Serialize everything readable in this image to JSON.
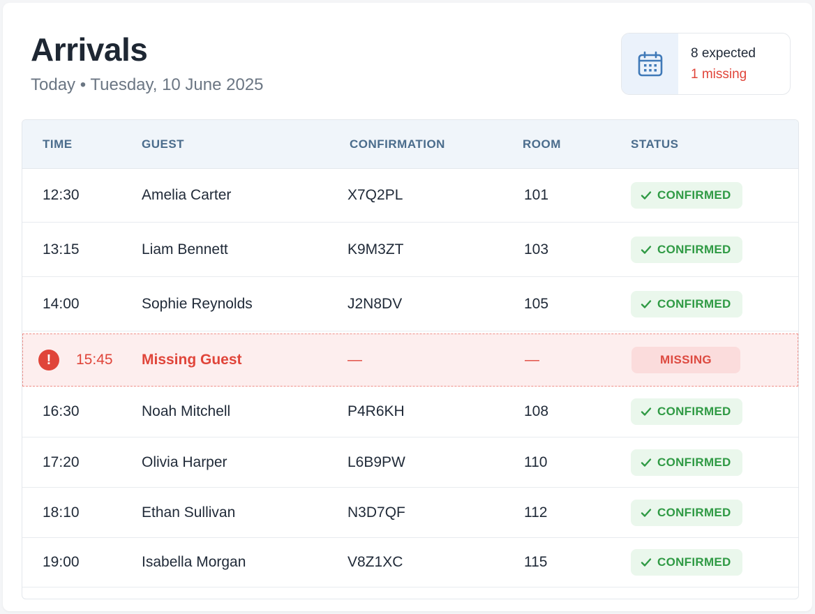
{
  "header": {
    "title": "Arrivals",
    "subtitle": "Today • Tuesday, 10 June 2025"
  },
  "summary": {
    "icon": "calendar-icon",
    "expected": "8 expected",
    "missing": "1 missing"
  },
  "table": {
    "columns": [
      "TIME",
      "GUEST",
      "CONFIRMATION",
      "ROOM",
      "STATUS"
    ],
    "rows": [
      {
        "time": "12:30",
        "guest": "Amelia Carter",
        "confirmation": "X7Q2PL",
        "room": "101",
        "status": "CONFIRMED"
      },
      {
        "time": "13:15",
        "guest": "Liam Bennett",
        "confirmation": "K9M3ZT",
        "room": "103",
        "status": "CONFIRMED"
      },
      {
        "time": "14:00",
        "guest": "Sophie Reynolds",
        "confirmation": "J2N8DV",
        "room": "105",
        "status": "CONFIRMED"
      },
      {
        "time": "15:45",
        "guest": "Missing Guest",
        "confirmation": "—",
        "room": "—",
        "status": "MISSING"
      },
      {
        "time": "16:30",
        "guest": "Noah Mitchell",
        "confirmation": "P4R6KH",
        "room": "108",
        "status": "CONFIRMED"
      },
      {
        "time": "17:20",
        "guest": "Olivia Harper",
        "confirmation": "L6B9PW",
        "room": "110",
        "status": "CONFIRMED"
      },
      {
        "time": "18:10",
        "guest": "Ethan Sullivan",
        "confirmation": "N3D7QF",
        "room": "112",
        "status": "CONFIRMED"
      },
      {
        "time": "19:00",
        "guest": "Isabella Morgan",
        "confirmation": "V8Z1XC",
        "room": "115",
        "status": "CONFIRMED"
      }
    ]
  },
  "colors": {
    "confirmed": "#2f9a44",
    "missing": "#e0453a",
    "header_text": "#4a6c8c"
  }
}
